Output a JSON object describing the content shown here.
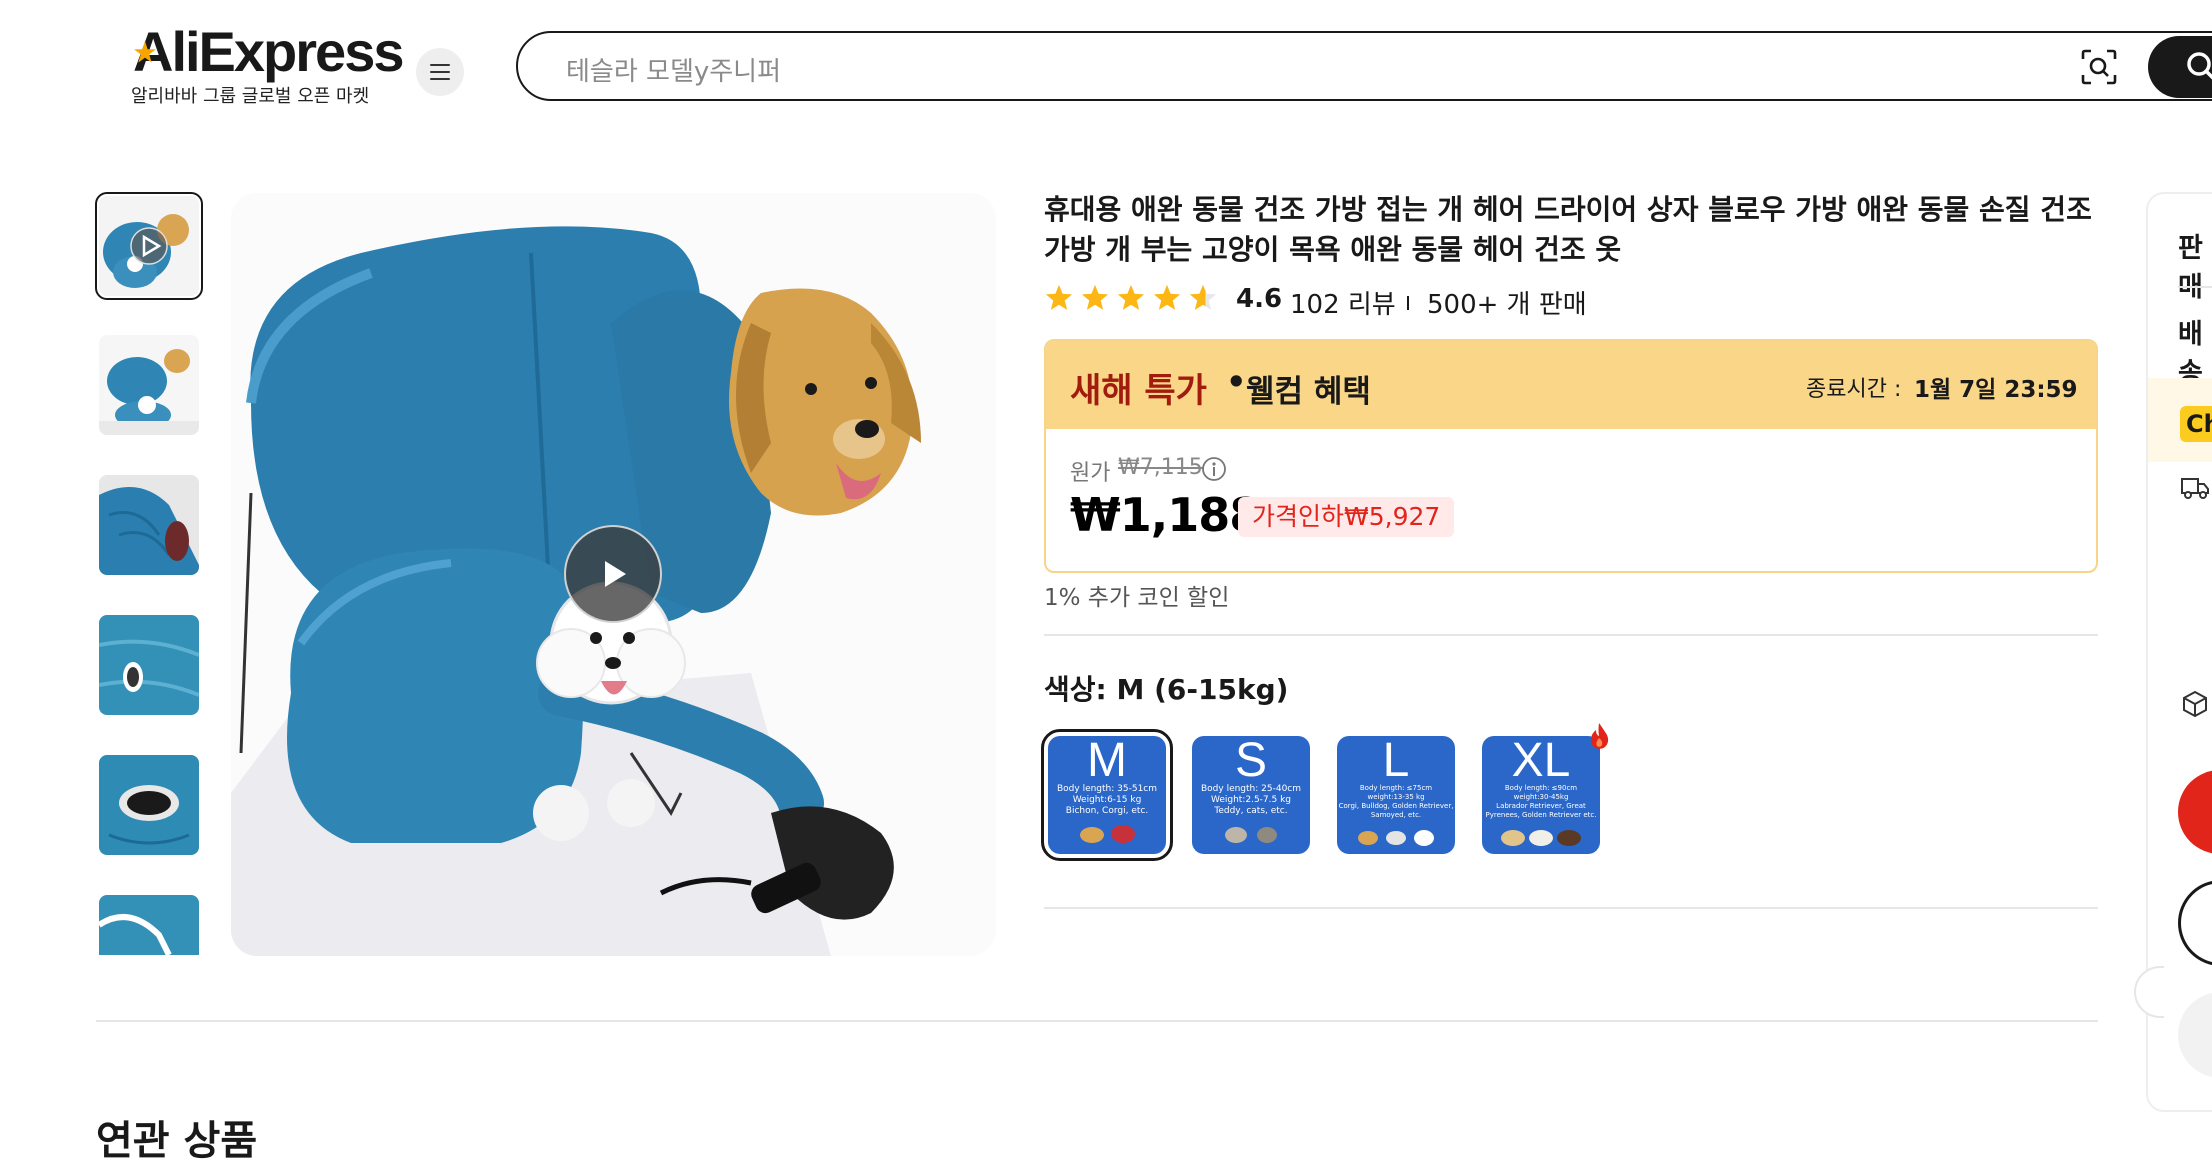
{
  "header": {
    "logo": "AliExpress",
    "logo_tagline": "알리바바 그룹 글로벌 오픈 마켓",
    "search_placeholder": "테슬라 모델y주니퍼",
    "icons": [
      "menu-icon",
      "camera-search-icon",
      "search-icon"
    ]
  },
  "gallery": {
    "thumbnails": [
      "video-thumb",
      "thumb-2",
      "thumb-3",
      "thumb-4",
      "thumb-5",
      "thumb-6"
    ],
    "selected_index": 0
  },
  "product": {
    "title": "휴대용 애완 동물 건조 가방 접는 개 헤어 드라이어 상자 블로우 가방 애완 동물 손질 건조 가방 개 부는 고양이 목욕 애완 동물 헤어 건조 옷",
    "rating": "4.6",
    "rating_value": 4.6,
    "reviews": "102 리뷰",
    "sold": "500+ 개 판매"
  },
  "price": {
    "deal_title": "새해 특가",
    "deal_dot": "•",
    "deal_subtitle": "웰컴 혜택",
    "end_label": "종료시간 :",
    "end_time": "1월 7일 23:59",
    "original_label": "원가",
    "original_price": "₩7,115",
    "current_price": "₩1,188",
    "discount_badge": "가격인하₩5,927",
    "coin_note": "1% 추가 코인 할인"
  },
  "variants": {
    "label": "색상: M (6-15kg)",
    "options": [
      {
        "size": "M",
        "line1": "Body length: 35-51cm",
        "line2": "Weight:6-15 kg",
        "line3": "Bichon, Corgi, etc."
      },
      {
        "size": "S",
        "line1": "Body length: 25-40cm",
        "line2": "Weight:2.5-7.5 kg",
        "line3": "Teddy, cats, etc."
      },
      {
        "size": "L",
        "line1": "Body length: ≤75cm",
        "line2": "weight:13-35 kg",
        "line3": "Corgi, Bulldog, Golden Retriever, Samoyed, etc."
      },
      {
        "size": "XL",
        "line1": "Body length: ≤90cm",
        "line2": "weight:30-45kg",
        "line3": "Labrador Retriever, Great Pyrenees, Golden Retriever etc."
      }
    ],
    "selected_index": 0,
    "hot_badge_on": "XL"
  },
  "related_heading": "연관 상품",
  "right_panel": {
    "seller": "판매",
    "shipping": "배송",
    "choice": "Ch"
  },
  "colors": {
    "accent_red": "#e1251b",
    "deal_red": "#a11b0e",
    "band_yellow": "#fad689",
    "star": "#fdb714",
    "option_blue": "#2a67c9"
  }
}
